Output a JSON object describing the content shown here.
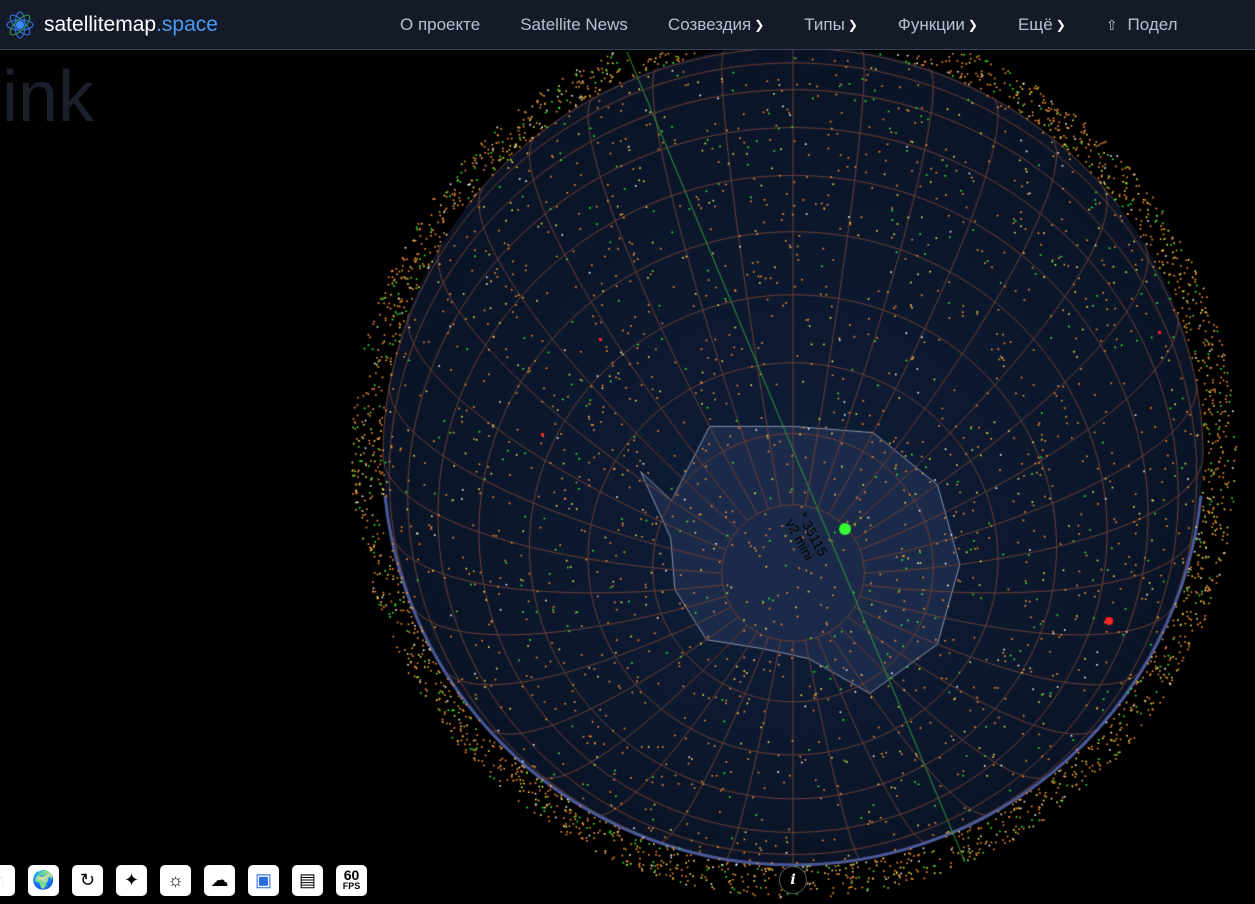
{
  "header": {
    "logo_main": "satellitemap",
    "logo_tld": ".space",
    "menu": [
      {
        "label": "О проекте",
        "dropdown": false
      },
      {
        "label": "Satellite News",
        "dropdown": false
      },
      {
        "label": "Созвездия",
        "dropdown": true
      },
      {
        "label": "Типы",
        "dropdown": true
      },
      {
        "label": "Функции",
        "dropdown": true
      },
      {
        "label": "Ещё",
        "dropdown": true
      },
      {
        "label": "Подел",
        "icon": "share-icon"
      }
    ]
  },
  "background_title": "ink",
  "globe": {
    "selected_satellite": {
      "id": "* 35115",
      "type": "v2 mini",
      "color": "#33ff33"
    },
    "ocean_color": "#0a1426",
    "land_color": "#1c2a4a",
    "grid_color": "#6b4035",
    "satellite_colors": [
      "#ff9933",
      "#ffee55",
      "#33ff33",
      "#ffffff",
      "#ff2222"
    ]
  },
  "toolbar": {
    "buttons": [
      {
        "name": "globe-dark-icon",
        "glyph": "◐"
      },
      {
        "name": "earth-texture-icon",
        "glyph": "🌍"
      },
      {
        "name": "rotate-icon",
        "glyph": "↻"
      },
      {
        "name": "stars-icon",
        "glyph": "✦"
      },
      {
        "name": "sun-icon",
        "glyph": "☼"
      },
      {
        "name": "clouds-icon",
        "glyph": "☁"
      },
      {
        "name": "satellite-3d-icon",
        "glyph": "▣"
      },
      {
        "name": "train-icon",
        "glyph": "▤"
      }
    ],
    "fps_value": "60",
    "fps_unit": "FPS"
  },
  "info_button": "i"
}
